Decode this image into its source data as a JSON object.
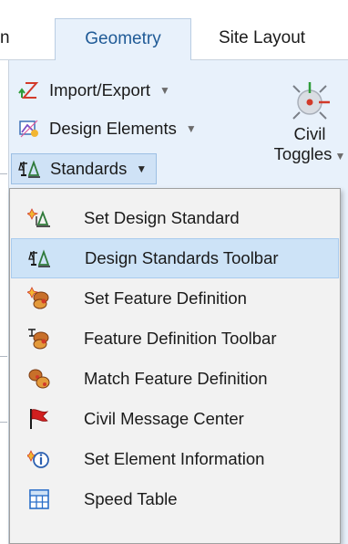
{
  "tabs": [
    {
      "label": "n",
      "selected": false
    },
    {
      "label": "Geometry",
      "selected": true
    },
    {
      "label": "Site Layout",
      "selected": false
    }
  ],
  "ribbon": {
    "import_export": {
      "label": "Import/Export",
      "icon": "import-export-icon"
    },
    "design_elements": {
      "label": "Design Elements",
      "icon": "design-elements-icon"
    },
    "standards": {
      "label": "Standards",
      "icon": "standards-icon",
      "expanded": true
    },
    "civil_toggles": {
      "line1": "Civil",
      "line2": "Toggles",
      "icon": "civil-toggles-icon"
    }
  },
  "menu": {
    "items": [
      {
        "label": "Set Design Standard",
        "icon": "set-design-standard-icon",
        "highlighted": false
      },
      {
        "label": "Design Standards Toolbar",
        "icon": "design-standards-toolbar-icon",
        "highlighted": true
      },
      {
        "label": "Set Feature Definition",
        "icon": "set-feature-definition-icon",
        "highlighted": false
      },
      {
        "label": "Feature Definition Toolbar",
        "icon": "feature-definition-toolbar-icon",
        "highlighted": false
      },
      {
        "label": "Match Feature Definition",
        "icon": "match-feature-definition-icon",
        "highlighted": false
      },
      {
        "label": "Civil Message Center",
        "icon": "civil-message-center-icon",
        "highlighted": false
      },
      {
        "label": "Set Element Information",
        "icon": "set-element-information-icon",
        "highlighted": false
      },
      {
        "label": "Speed Table",
        "icon": "speed-table-icon",
        "highlighted": false
      }
    ]
  },
  "colors": {
    "ribbon_bg": "#e8f1fb",
    "selected_tab_text": "#1f5a96",
    "menu_bg": "#f2f2f2",
    "menu_highlight": "#cde3f7"
  }
}
